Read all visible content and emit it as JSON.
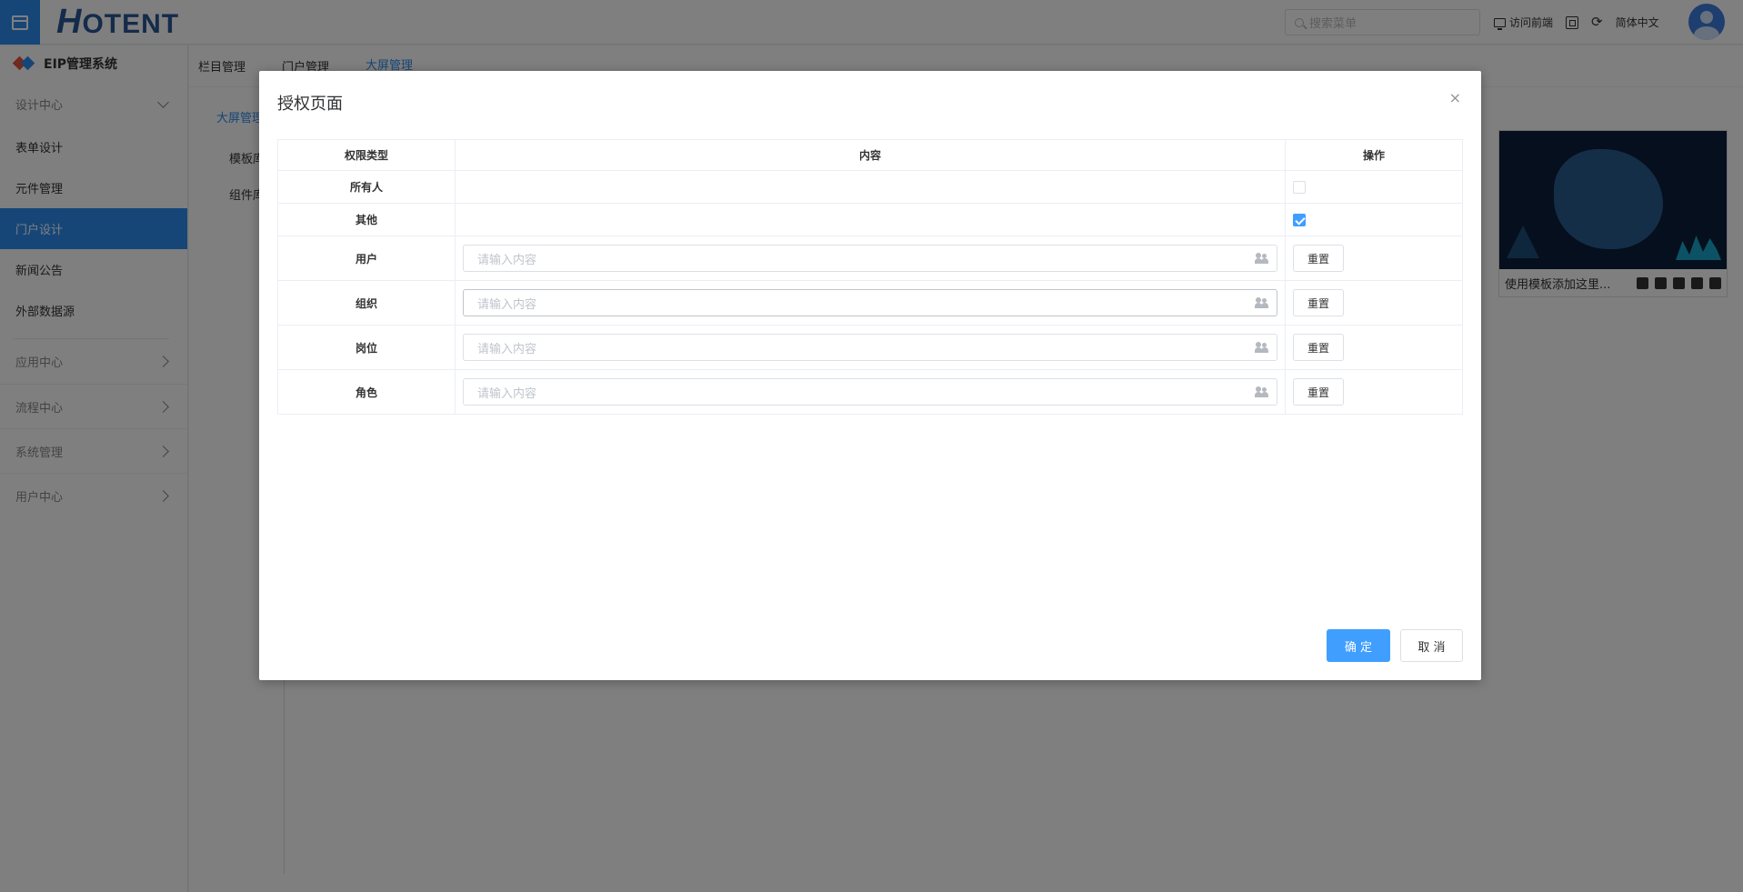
{
  "header": {
    "logo": "HOTENT",
    "search_placeholder": "搜索菜单",
    "visit_frontend": "访问前端",
    "language": "简体中文"
  },
  "sidebar": {
    "system_title": "EIP管理系统",
    "design_center": "设计中心",
    "items": [
      {
        "label": "表单设计",
        "active": false
      },
      {
        "label": "元件管理",
        "active": false
      },
      {
        "label": "门户设计",
        "active": true
      },
      {
        "label": "新闻公告",
        "active": false
      },
      {
        "label": "外部数据源",
        "active": false
      }
    ],
    "groups": [
      "应用中心",
      "流程中心",
      "系统管理",
      "用户中心"
    ]
  },
  "tabs": [
    "栏目管理",
    "门户管理",
    "大屏管理"
  ],
  "inner_nav": {
    "header": "大屏管理",
    "items": [
      "模板库",
      "组件库"
    ]
  },
  "card": {
    "caption": "使用模板添加这里..."
  },
  "dialog": {
    "title": "授权页面",
    "close": "×",
    "columns": [
      "权限类型",
      "内容",
      "操作"
    ],
    "rows": {
      "everyone": {
        "label": "所有人",
        "checked": false
      },
      "other": {
        "label": "其他",
        "checked": true
      },
      "user": {
        "label": "用户",
        "placeholder": "请输入内容",
        "reset": "重置"
      },
      "org": {
        "label": "组织",
        "placeholder": "请输入内容",
        "reset": "重置"
      },
      "post": {
        "label": "岗位",
        "placeholder": "请输入内容",
        "reset": "重置"
      },
      "role": {
        "label": "角色",
        "placeholder": "请输入内容",
        "reset": "重置"
      }
    },
    "ok": "确 定",
    "cancel": "取 消"
  }
}
